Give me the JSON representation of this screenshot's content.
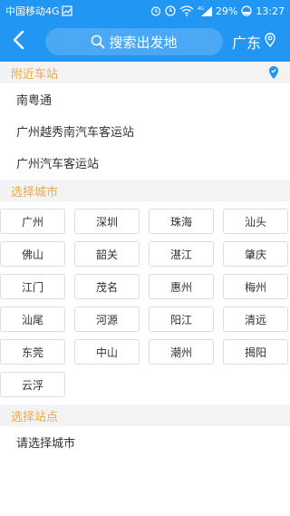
{
  "status_bar": {
    "carrier": "中国移动4G",
    "battery": "29%",
    "time": "13:27",
    "network_label": "4G"
  },
  "header": {
    "search_placeholder": "搜索出发地",
    "province": "广东"
  },
  "nearby": {
    "title": "附近车站",
    "stations": [
      "南粤通",
      "广州越秀南汽车客运站",
      "广州汽车客运站"
    ]
  },
  "city_section": {
    "title": "选择城市",
    "cities": [
      "广州",
      "深圳",
      "珠海",
      "汕头",
      "佛山",
      "韶关",
      "湛江",
      "肇庆",
      "江门",
      "茂名",
      "惠州",
      "梅州",
      "汕尾",
      "河源",
      "阳江",
      "清远",
      "东莞",
      "中山",
      "潮州",
      "揭阳",
      "云浮"
    ]
  },
  "station_section": {
    "title": "选择站点",
    "hint": "请选择城市"
  },
  "colors": {
    "primary": "#2196f3",
    "section_text": "#f0a848",
    "section_bg": "#f3f3f3"
  }
}
